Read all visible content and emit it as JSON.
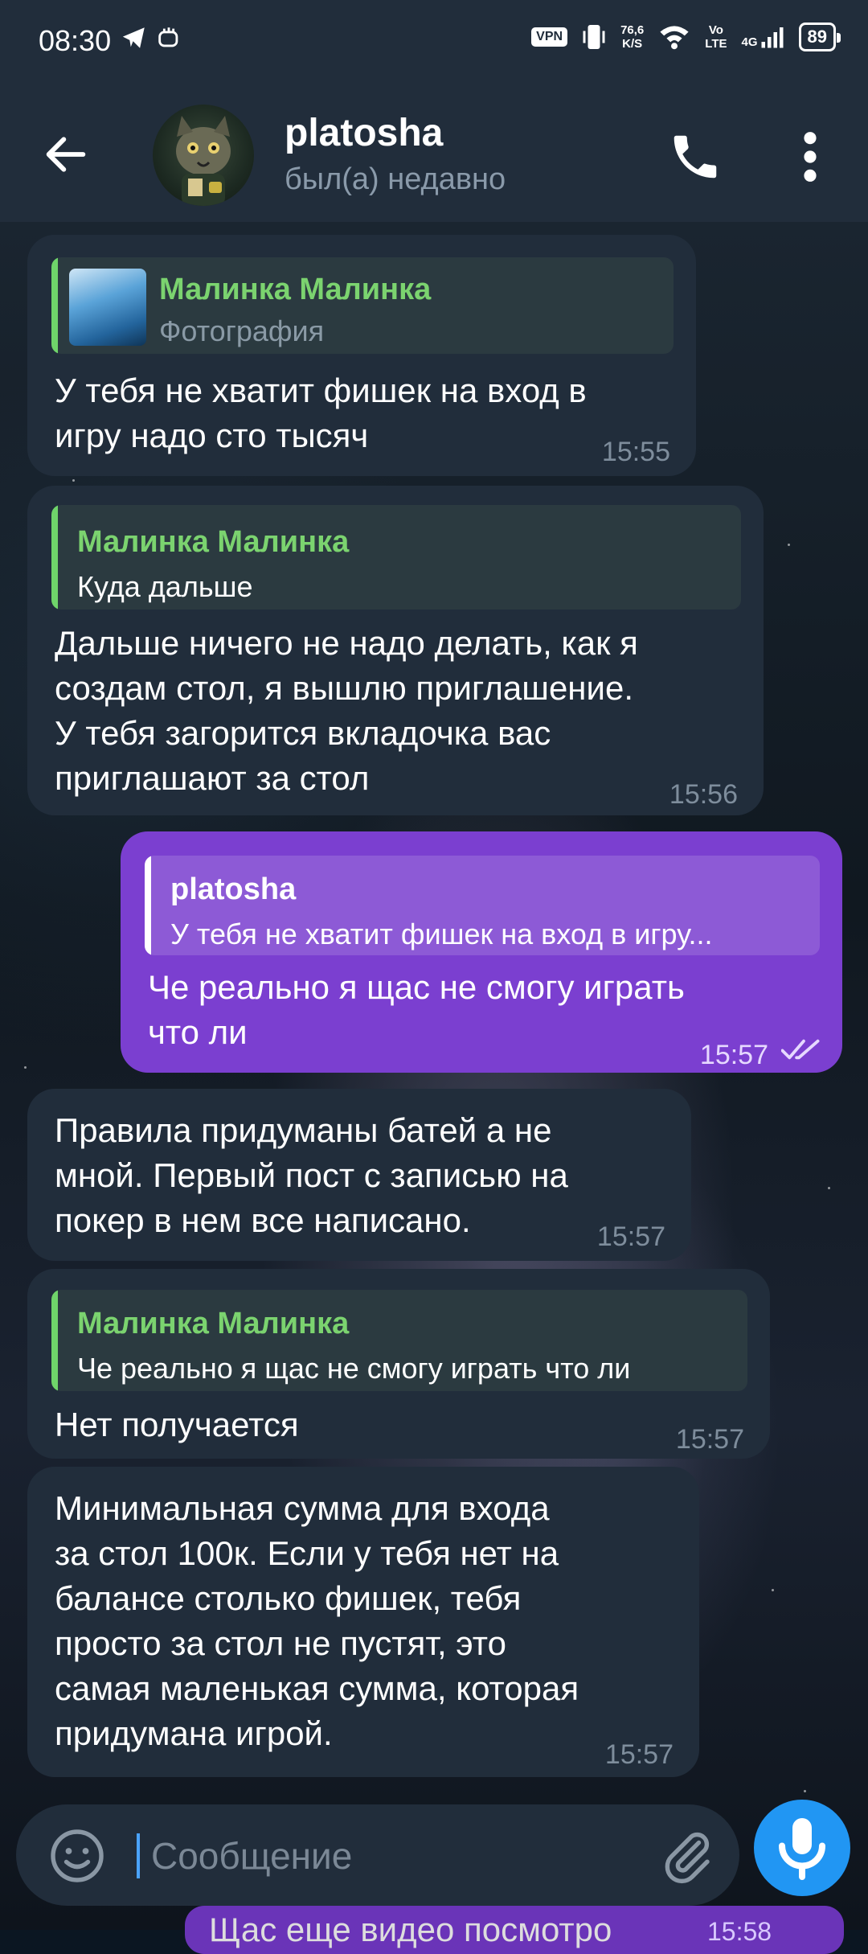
{
  "status_bar": {
    "time": "08:30",
    "vpn": "VPN",
    "speed_value": "76,6",
    "speed_unit": "K/S",
    "volte_top": "Vo",
    "volte_bottom": "LTE",
    "network": "4G",
    "battery": "89"
  },
  "header": {
    "name": "platosha",
    "status": "был(а) недавно"
  },
  "messages": [
    {
      "direction": "in",
      "reply_name": "Малинка Малинка",
      "reply_text": "Фотография",
      "text": "У тебя не хватит фишек на вход в\nигру надо сто тысяч",
      "time": "15:55"
    },
    {
      "direction": "in",
      "reply_name": "Малинка Малинка",
      "reply_text": "Куда дальше",
      "text": "Дальше ничего не надо делать, как я\nсоздам стол, я вышлю приглашение.\nУ тебя загорится вкладочка вас\nприглашают за стол",
      "time": "15:56"
    },
    {
      "direction": "out",
      "reply_name": "platosha",
      "reply_text": "У тебя не хватит фишек на вход в игру...",
      "text": "Че реально я щас не смогу играть\nчто ли",
      "time": "15:57"
    },
    {
      "direction": "in",
      "text": "Правила придуманы батей а не\nмной. Первый пост с записью на\nпокер в нем все написано.",
      "time": "15:57"
    },
    {
      "direction": "in",
      "reply_name": "Малинка Малинка",
      "reply_text": "Че реально я щас не смогу играть что ли",
      "text": "Нет получается",
      "time": "15:57"
    },
    {
      "direction": "in",
      "text": "Минимальная сумма для входа\nза стол 100к. Если у тебя нет на\nбалансе столько фишек, тебя\nпросто за стол не пустят, это\nсамая маленькая сумма, которая\nпридумана игрой.",
      "time": "15:57"
    }
  ],
  "partial_message": {
    "text": "Щас еще видео посмотро",
    "time": "15:58"
  },
  "composer": {
    "placeholder": "Сообщение"
  },
  "colors": {
    "header_bg": "#212d3b",
    "incoming_bubble": "#212d3b",
    "outgoing_bubble": "#7b3fd0",
    "reply_accent": "#6fd46a",
    "mic_button": "#2196f3"
  }
}
